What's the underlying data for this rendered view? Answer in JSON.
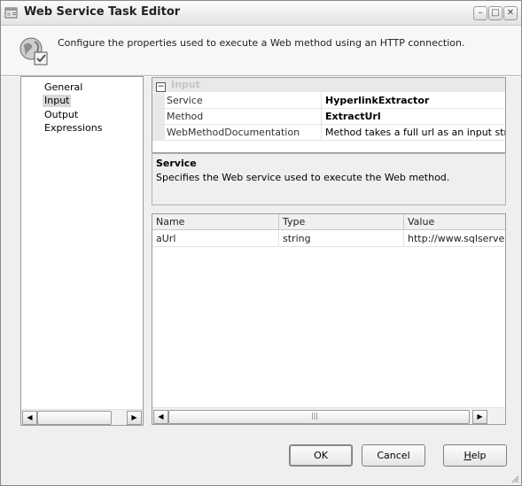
{
  "window": {
    "title": "Web Service Task Editor",
    "icon": "task-editor-icon"
  },
  "header": {
    "description": "Configure the properties used to execute a Web method using an HTTP connection.",
    "icon": "web-service-globe-icon"
  },
  "nav": {
    "items": [
      {
        "label": "General",
        "selected": false
      },
      {
        "label": "Input",
        "selected": true
      },
      {
        "label": "Output",
        "selected": false
      },
      {
        "label": "Expressions",
        "selected": false
      }
    ]
  },
  "property_grid": {
    "category": "Input",
    "rows": [
      {
        "name": "Service",
        "value": "HyperlinkExtractor",
        "bold": true
      },
      {
        "name": "Method",
        "value": "ExtractUrl",
        "bold": true
      },
      {
        "name": "WebMethodDocumentation",
        "value": "Method takes a full url as an input string a",
        "bold": false
      }
    ]
  },
  "description_panel": {
    "title": "Service",
    "text": "Specifies the Web service used to execute the Web method."
  },
  "parameters": {
    "columns": [
      "Name",
      "Type",
      "Value"
    ],
    "rows": [
      {
        "name": "aUrl",
        "type": "string",
        "value": "http://www.sqlserver"
      }
    ]
  },
  "buttons": {
    "ok": "OK",
    "cancel": "Cancel",
    "help_prefix": "H",
    "help_rest": "elp"
  },
  "colors": {
    "window_bg": "#efefef",
    "selection": "#d8d8d8"
  }
}
